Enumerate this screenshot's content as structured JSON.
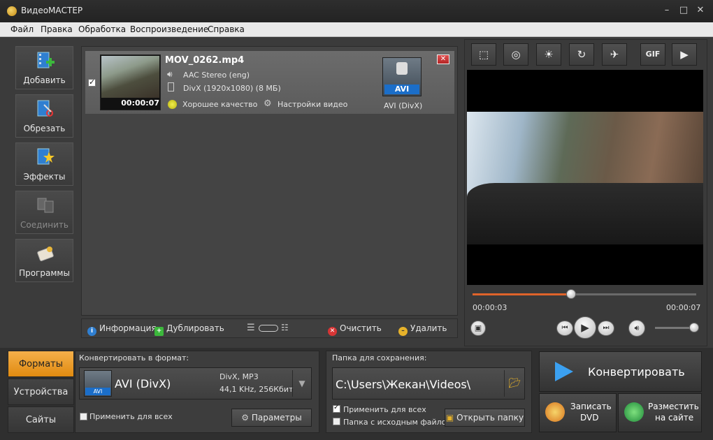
{
  "window": {
    "title": "ВидеоМАСТЕР"
  },
  "menu": [
    "Файл",
    "Правка",
    "Обработка",
    "Воспроизведение",
    "Справка"
  ],
  "sidebar": [
    {
      "label": "Добавить",
      "icon": "add-film-icon",
      "enabled": true
    },
    {
      "label": "Обрезать",
      "icon": "cut-film-icon",
      "enabled": true
    },
    {
      "label": "Эффекты",
      "icon": "effects-icon",
      "enabled": true
    },
    {
      "label": "Соединить",
      "icon": "join-icon",
      "enabled": false
    },
    {
      "label": "Программы",
      "icon": "programs-icon",
      "enabled": true
    }
  ],
  "file": {
    "name": "MOV_0262.mp4",
    "duration": "00:00:07",
    "audio": "AAC Stereo (eng)",
    "video": "DivX (1920x1080) (8 МБ)",
    "quality": "Хорошее качество",
    "settings": "Настройки видео",
    "format_badge": "AVI",
    "format_label": "AVI (DivX)",
    "checked": true
  },
  "listbar": {
    "info": "Информация",
    "duplicate": "Дублировать",
    "clear": "Очистить",
    "delete": "Удалить"
  },
  "preview": {
    "current_time": "00:00:03",
    "total_time": "00:00:07",
    "progress": 0.44,
    "volume": 0.9,
    "tools": [
      "crop-icon",
      "stabilize-icon",
      "brightness-icon",
      "rotate-icon",
      "speed-icon",
      "gif-icon",
      "slideshow-icon"
    ],
    "gif_label": "GIF"
  },
  "tabs": [
    "Форматы",
    "Устройства",
    "Сайты"
  ],
  "convert": {
    "label": "Конвертировать в формат:",
    "format": "AVI (DivX)",
    "badge": "AVI",
    "codec": "DivX, MP3",
    "audio": "44,1 KHz, 256Кбит",
    "apply_all": "Применить для всех",
    "params": "Параметры"
  },
  "save": {
    "label": "Папка для сохранения:",
    "path": "C:\\Users\\Жекан\\Videos\\",
    "apply_all": "Применить для всех",
    "apply_checked": true,
    "source_folder": "Папка с исходным файлом",
    "source_checked": false,
    "open_folder": "Открыть папку"
  },
  "actions": {
    "convert": "Конвертировать",
    "dvd_line1": "Записать",
    "dvd_line2": "DVD",
    "web_line1": "Разместить",
    "web_line2": "на сайте"
  },
  "colors": {
    "accent": "#e08a10",
    "progress": "#e0632a",
    "badge_blue": "#1b6ec9"
  }
}
